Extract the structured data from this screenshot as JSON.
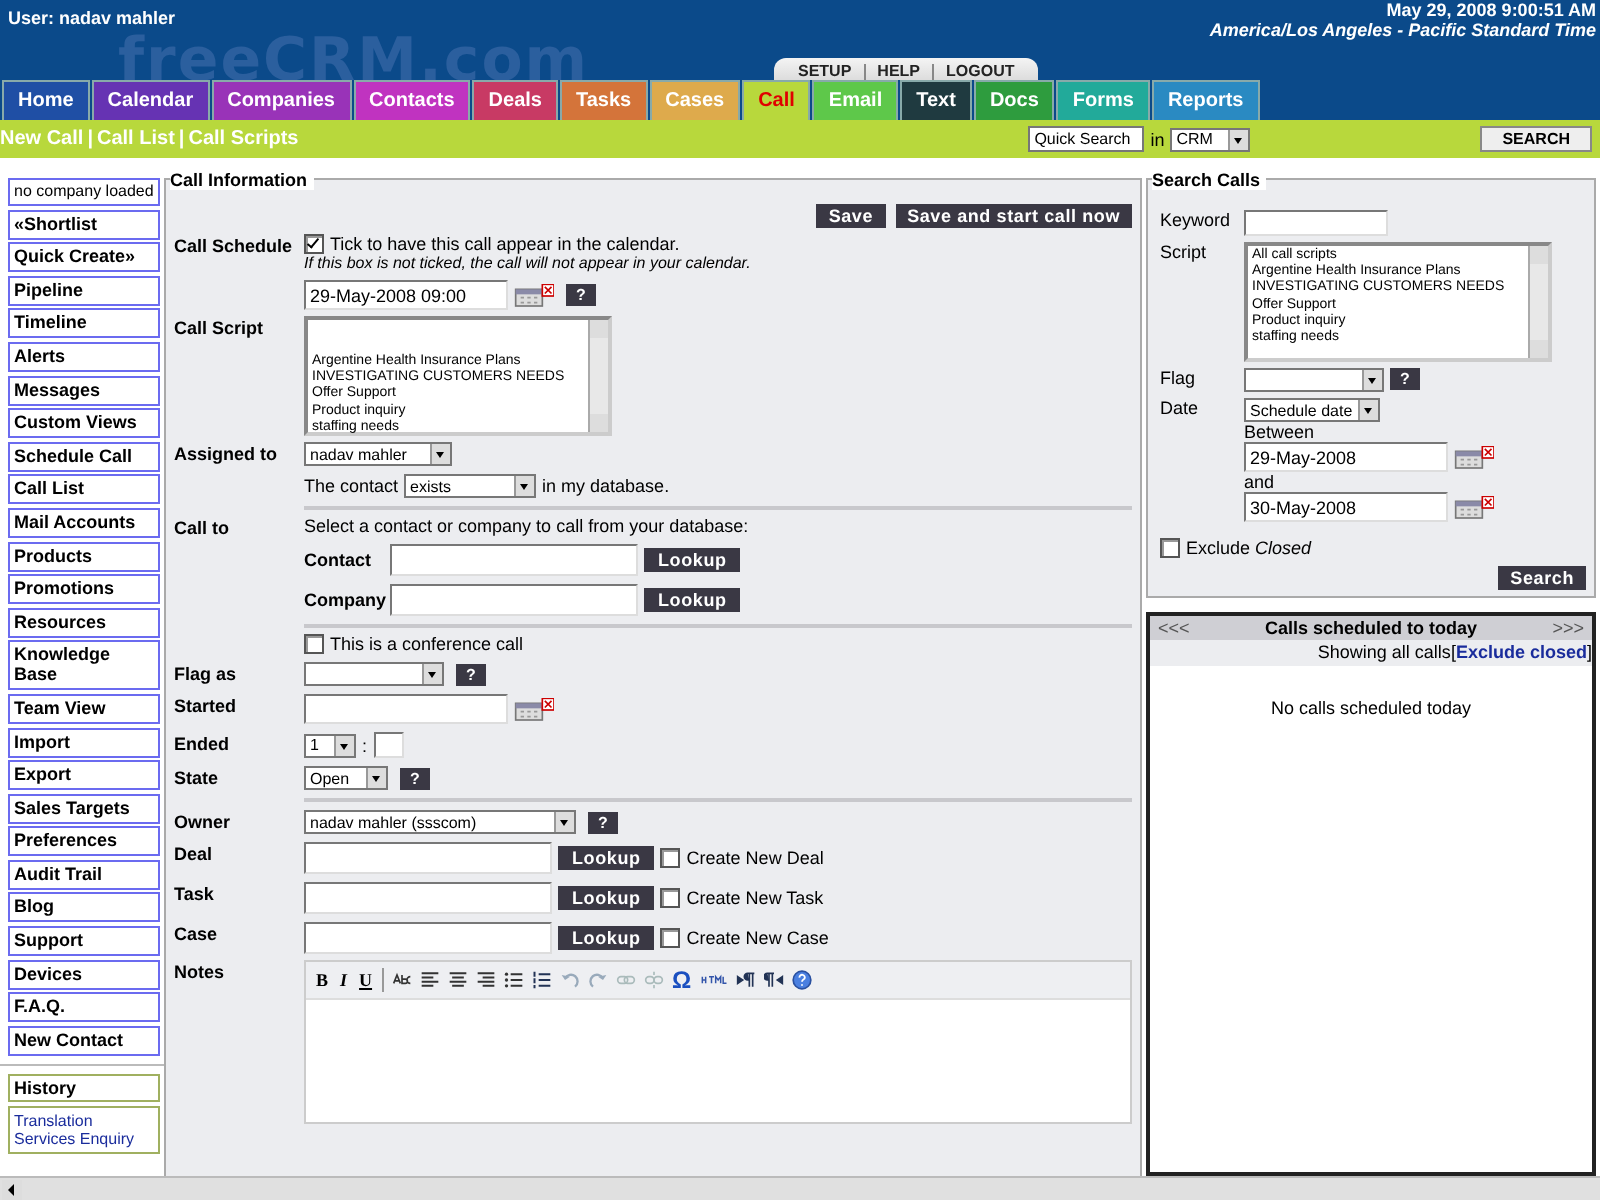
{
  "header": {
    "user": "User: nadav mahler",
    "logo": "freeCRM.com",
    "date": "May 29, 2008 9:00:51 AM",
    "timezone": "America/Los Angeles - Pacific Standard Time",
    "top_links": [
      "SETUP",
      "HELP",
      "LOGOUT"
    ]
  },
  "tabs": [
    {
      "label": "Home",
      "color": "#1f4fa5",
      "selected": false
    },
    {
      "label": "Calendar",
      "color": "#6633b3",
      "selected": false
    },
    {
      "label": "Companies",
      "color": "#9933b8",
      "selected": false
    },
    {
      "label": "Contacts",
      "color": "#c033c0",
      "selected": false
    },
    {
      "label": "Deals",
      "color": "#c83a64",
      "selected": false
    },
    {
      "label": "Tasks",
      "color": "#d4743a",
      "selected": false
    },
    {
      "label": "Cases",
      "color": "#deaa4c",
      "selected": false
    },
    {
      "label": "Call",
      "color": "#b8d83c",
      "selected": true
    },
    {
      "label": "Email",
      "color": "#5ec84a",
      "selected": false
    },
    {
      "label": "Text",
      "color": "#1f3a40",
      "selected": false
    },
    {
      "label": "Docs",
      "color": "#2e9c3e",
      "selected": false
    },
    {
      "label": "Forms",
      "color": "#22aa9a",
      "selected": false
    },
    {
      "label": "Reports",
      "color": "#2a8ac2",
      "selected": false
    }
  ],
  "subnav": {
    "links": [
      "New Call",
      "Call List",
      "Call Scripts"
    ],
    "separator": "|",
    "quick_search": "Quick Search",
    "in_label": "in",
    "scope": "CRM",
    "search_button": "SEARCH"
  },
  "sidebar": {
    "company": "no company loaded",
    "items": [
      "«Shortlist",
      "Quick Create»",
      "Pipeline",
      "Timeline",
      "Alerts",
      "Messages",
      "Custom Views",
      "Schedule Call",
      "Call List",
      "Mail Accounts",
      "Products",
      "Promotions",
      "Resources",
      "Knowledge Base",
      "Team View",
      "Import",
      "Export",
      "Sales Targets",
      "Preferences",
      "Audit Trail",
      "Blog",
      "Support",
      "Devices",
      "F.A.Q.",
      "New Contact"
    ],
    "history_title": "History",
    "history_links": [
      "Translation Services Enquiry"
    ]
  },
  "call_info": {
    "legend": "Call Information",
    "buttons": [
      "Save",
      "Save and start call now"
    ],
    "schedule": {
      "label": "Call Schedule",
      "checked": true,
      "text": "Tick to have this call appear in the calendar.",
      "note": "If this box is not ticked, the call will not appear in your calendar.",
      "datetime": "29-May-2008 09:00",
      "help": "?"
    },
    "script": {
      "label": "Call Script",
      "options": [
        "Argentine Health Insurance Plans",
        "INVESTIGATING CUSTOMERS NEEDS",
        "Offer Support",
        "Product inquiry",
        "staffing needs"
      ]
    },
    "assigned": {
      "label": "Assigned to",
      "value": "nadav mahler",
      "contact_prefix": "The contact",
      "contact_value": "exists",
      "contact_suffix": "in my database."
    },
    "call_to": {
      "label": "Call to",
      "intro": "Select a contact or company to call from your database:",
      "rows": [
        {
          "label": "Contact",
          "button": "Lookup"
        },
        {
          "label": "Company",
          "button": "Lookup"
        }
      ]
    },
    "conference": {
      "checked": false,
      "label": "This is a conference call"
    },
    "flag": {
      "label": "Flag as",
      "help": "?"
    },
    "started": {
      "label": "Started"
    },
    "ended": {
      "label": "Ended",
      "hour": "1",
      "separator": ":"
    },
    "state": {
      "label": "State",
      "value": "Open",
      "help": "?"
    },
    "owner": {
      "label": "Owner",
      "value": "nadav mahler (ssscom)",
      "help": "?"
    },
    "links": [
      {
        "label": "Deal",
        "button": "Lookup",
        "create_label": "Create New Deal",
        "create_checked": false
      },
      {
        "label": "Task",
        "button": "Lookup",
        "create_label": "Create New Task",
        "create_checked": false
      },
      {
        "label": "Case",
        "button": "Lookup",
        "create_label": "Create New Case",
        "create_checked": false
      }
    ],
    "notes": {
      "label": "Notes",
      "format_buttons": [
        "B",
        "I",
        "U"
      ],
      "symbol": "Ω"
    }
  },
  "search_calls": {
    "legend": "Search Calls",
    "keyword_label": "Keyword",
    "script_label": "Script",
    "script_options": [
      "All call scripts",
      "Argentine Health Insurance Plans",
      "INVESTIGATING CUSTOMERS NEEDS",
      "Offer Support",
      "Product inquiry",
      "staffing needs"
    ],
    "flag_label": "Flag",
    "help": "?",
    "date_label": "Date",
    "date_type": "Schedule date",
    "between": "Between",
    "from": "29-May-2008",
    "and": "and",
    "to": "30-May-2008",
    "exclude_checked": false,
    "exclude_label": "Exclude *Closed*",
    "search_button": "Search"
  },
  "today": {
    "prev": "<<<",
    "title": "Calls scheduled to today",
    "next": ">>>",
    "showing": "Showing all calls",
    "bracket_open": "[",
    "filter_link": "Exclude closed",
    "bracket_close": "]",
    "empty": "No calls scheduled today"
  }
}
